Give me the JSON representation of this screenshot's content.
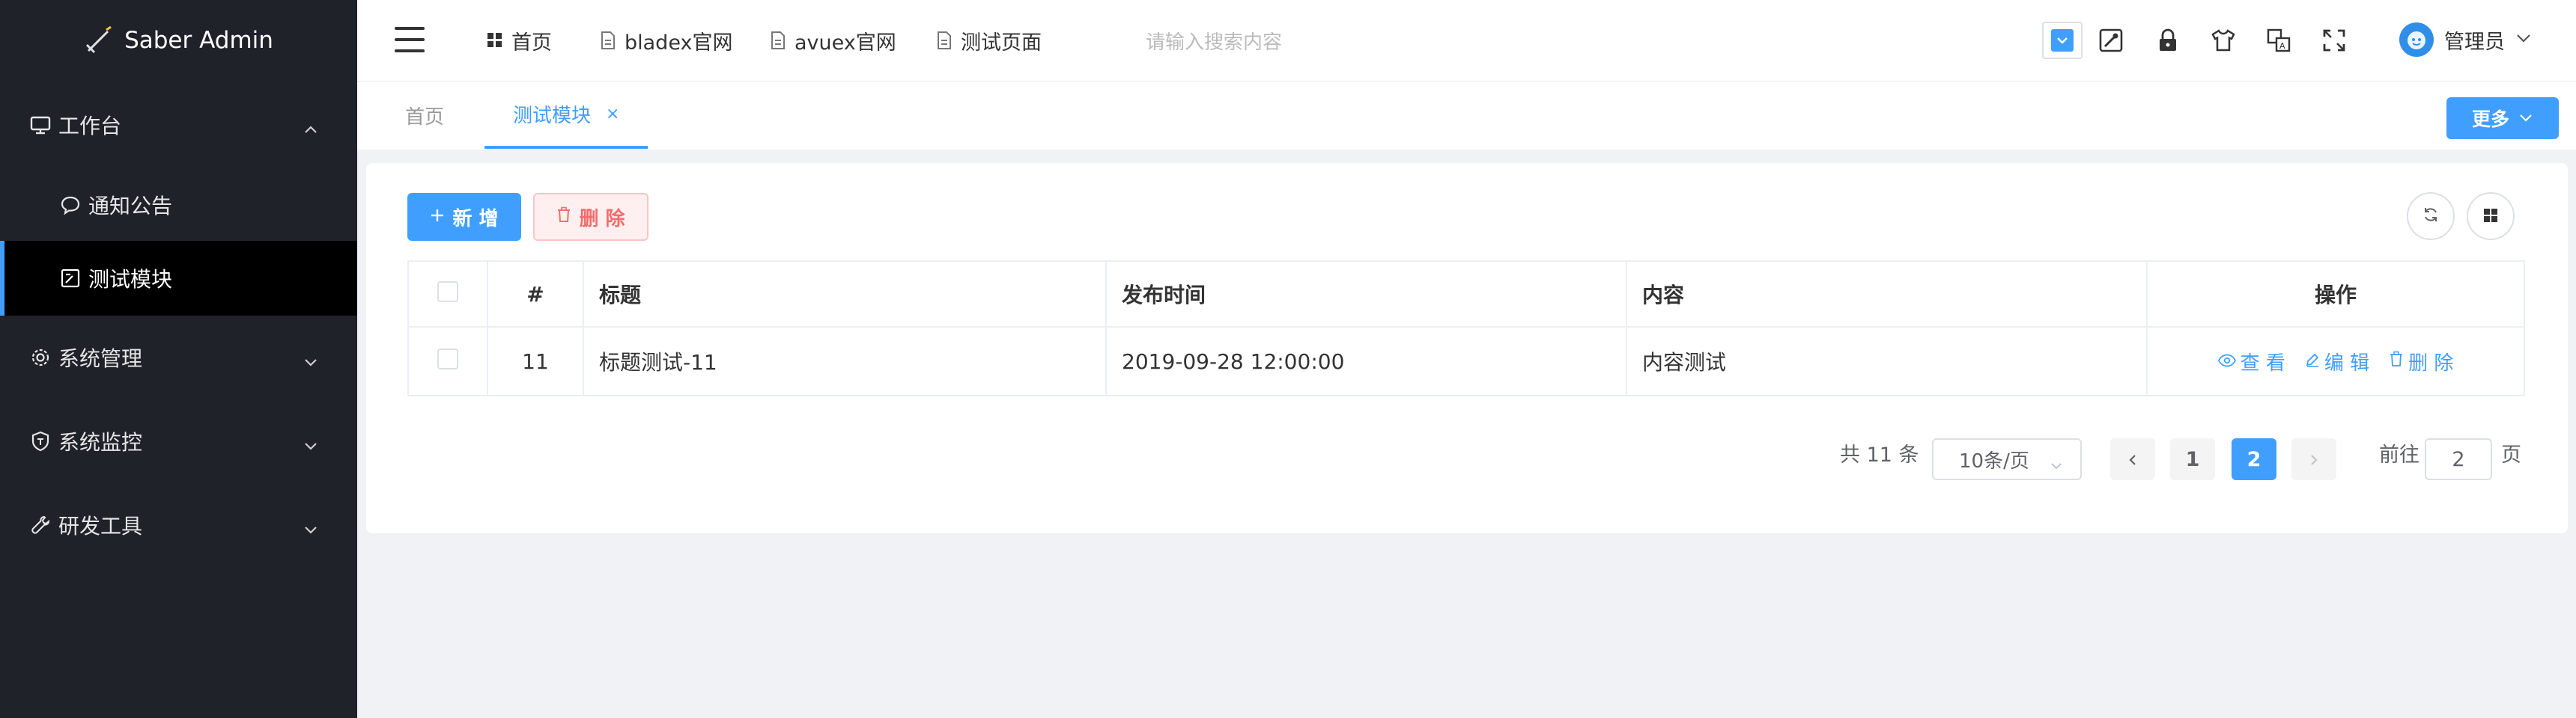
{
  "app": {
    "title": "Saber Admin"
  },
  "sidebar": {
    "items": [
      {
        "label": "工作台"
      },
      {
        "label": "通知公告"
      },
      {
        "label": "测试模块"
      },
      {
        "label": "系统管理"
      },
      {
        "label": "系统监控"
      },
      {
        "label": "研发工具"
      }
    ]
  },
  "header": {
    "nav": [
      {
        "label": "首页"
      },
      {
        "label": "bladex官网"
      },
      {
        "label": "avuex官网"
      },
      {
        "label": "测试页面"
      }
    ],
    "search_placeholder": "请输入搜索内容",
    "user_name": "管理员"
  },
  "tabs": {
    "items": [
      {
        "label": "首页"
      },
      {
        "label": "测试模块"
      }
    ],
    "close_symbol": "×",
    "more_label": "更多"
  },
  "toolbar": {
    "add_label": "新 增",
    "delete_label": "删 除"
  },
  "table": {
    "columns": [
      "#",
      "标题",
      "发布时间",
      "内容",
      "操作"
    ],
    "rows": [
      {
        "index": "11",
        "title": "标题测试-11",
        "time": "2019-09-28 12:00:00",
        "content": "内容测试",
        "actions": {
          "view": "查 看",
          "edit": "编 辑",
          "delete": "删 除"
        }
      }
    ]
  },
  "pagination": {
    "total_text": "共 11 条",
    "page_size": "10条/页",
    "pages": [
      "1",
      "2"
    ],
    "current_page": "2",
    "goto_label": "前往",
    "goto_value": "2",
    "goto_unit": "页"
  },
  "colors": {
    "primary": "#409eff",
    "danger": "#f56c6c",
    "sidebar_bg": "#20222a"
  }
}
